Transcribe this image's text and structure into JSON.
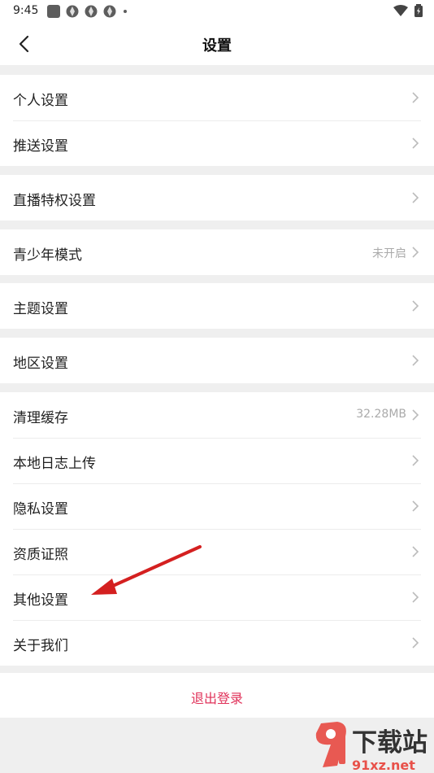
{
  "status_bar": {
    "time": "9:45"
  },
  "header": {
    "title": "设置"
  },
  "groups": [
    {
      "items": [
        {
          "label": "个人设置"
        },
        {
          "label": "推送设置"
        }
      ]
    },
    {
      "items": [
        {
          "label": "直播特权设置"
        }
      ]
    },
    {
      "items": [
        {
          "label": "青少年模式",
          "value": "未开启"
        }
      ]
    },
    {
      "items": [
        {
          "label": "主题设置"
        }
      ]
    },
    {
      "items": [
        {
          "label": "地区设置"
        }
      ]
    },
    {
      "items": [
        {
          "label": "清理缓存",
          "value": "32.28MB"
        },
        {
          "label": "本地日志上传"
        },
        {
          "label": "隐私设置"
        },
        {
          "label": "资质证照"
        },
        {
          "label": "其他设置"
        },
        {
          "label": "关于我们"
        }
      ]
    }
  ],
  "logout_label": "退出登录",
  "watermark": {
    "text": "下载站",
    "url_text": "91xz.net"
  },
  "colors": {
    "accent": "#e0325a",
    "annotation_arrow": "#d42020",
    "background": "#efefef"
  }
}
